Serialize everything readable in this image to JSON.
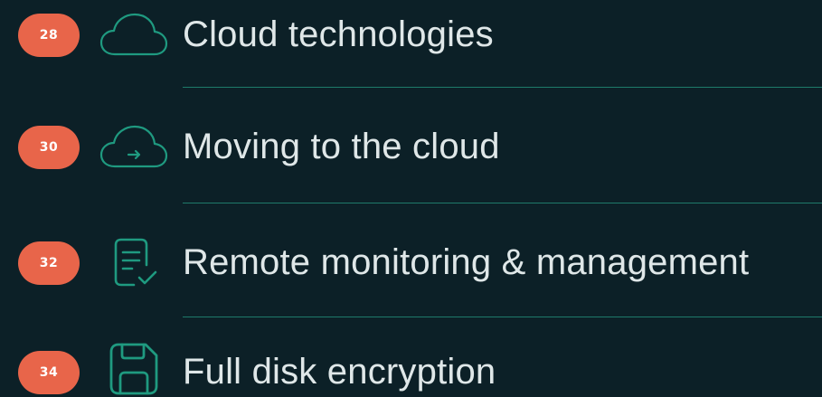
{
  "colors": {
    "background": "#0c2027",
    "badge": "#e8654a",
    "icon": "#1f9a80",
    "divider": "#1e7a6a",
    "text": "#dfe7e8"
  },
  "items": [
    {
      "page": "28",
      "title": "Cloud technologies",
      "icon": "cloud-icon"
    },
    {
      "page": "30",
      "title": "Moving to the cloud",
      "icon": "cloud-arrow-icon"
    },
    {
      "page": "32",
      "title": "Remote monitoring & management",
      "icon": "checklist-document-icon"
    },
    {
      "page": "34",
      "title": "Full disk encryption",
      "icon": "floppy-disk-icon"
    }
  ]
}
